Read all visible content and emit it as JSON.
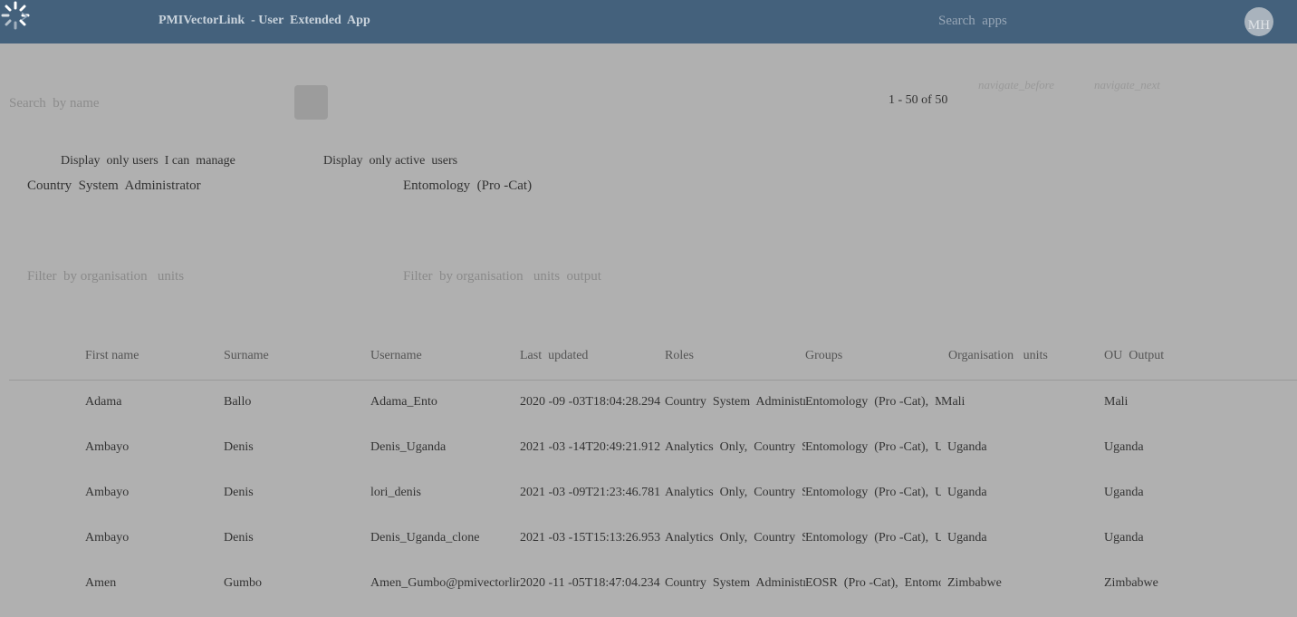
{
  "header": {
    "title": "PMIVectorLink  - User  Extended  App",
    "apps_search": "Search  apps",
    "avatar_initials": "MH"
  },
  "search": {
    "placeholder": "Search  by name"
  },
  "pagination": {
    "range": "1 - 50 of 50",
    "prev_label": "navigate_before",
    "next_label": "navigate_next"
  },
  "filters": {
    "manage_label": "Display  only users  I can  manage",
    "active_label": "Display  only active  users",
    "role_value": "Country  System  Administrator",
    "group_value": "Entomology  (Pro -Cat)",
    "ou_placeholder": "Filter  by organisation   units",
    "ou_output_placeholder": "Filter  by organisation   units  output"
  },
  "table": {
    "columns": [
      "First name",
      "Surname",
      "Username",
      "Last  updated",
      "Roles",
      "Groups",
      "Organisation   units",
      "OU  Output"
    ],
    "rows": [
      [
        "Adama",
        "Ballo",
        "Adama_Ento",
        "2020 -09 -03T18:04:28.294",
        "Country  System  Administrator",
        "Entomology  (Pro -Cat),  MRC",
        "Mali",
        "Mali"
      ],
      [
        "Ambayo",
        "Denis",
        "Denis_Uganda",
        "2021 -03 -14T20:49:21.912",
        "Analytics  Only,  Country  System",
        "Entomology  (Pro -Cat),  UCC",
        "Uganda",
        "Uganda"
      ],
      [
        "Ambayo",
        "Denis",
        "lori_denis",
        "2021 -03 -09T21:23:46.781",
        "Analytics  Only,  Country  System",
        "Entomology  (Pro -Cat),  UCC",
        "Uganda",
        "Uganda"
      ],
      [
        "Ambayo",
        "Denis",
        "Denis_Uganda_clone",
        "2021 -03 -15T15:13:26.953",
        "Analytics  Only,  Country  System",
        "Entomology  (Pro -Cat),  UCC",
        "Uganda",
        "Uganda"
      ],
      [
        "Amen",
        "Gumbo",
        "Amen_Gumbo@pmivectorlink.org",
        "2020 -11 -05T18:47:04.234",
        "Country  System  Administrator",
        "EOSR  (Pro -Cat),  Entomology",
        "Zimbabwe",
        "Zimbabwe"
      ]
    ]
  }
}
